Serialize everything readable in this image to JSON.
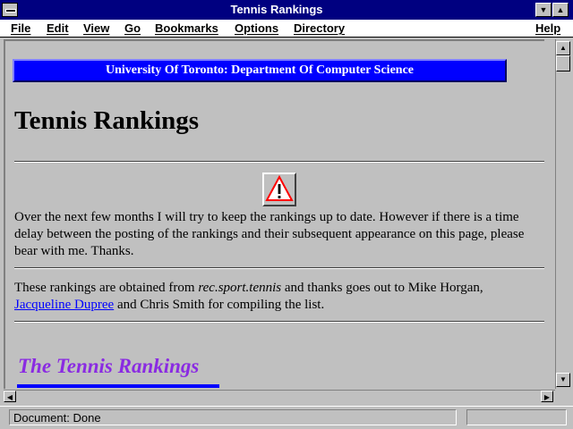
{
  "window": {
    "title": "Tennis Rankings"
  },
  "titlebar": {
    "minimize_glyph": "▼",
    "maximize_glyph": "▲"
  },
  "menu": {
    "file": "File",
    "edit": "Edit",
    "view": "View",
    "go": "Go",
    "bookmarks": "Bookmarks",
    "options": "Options",
    "directory": "Directory",
    "help": "Help"
  },
  "page": {
    "banner": "University Of Toronto: Department Of Computer Science",
    "title": "Tennis Rankings",
    "warning_icon": "warning-triangle-icon",
    "intro": "Over the next few months I will try to keep the rankings up to date. However if there is a time delay between the posting of the rankings and their subsequent appearance on this page, please bear with me. Thanks.",
    "source_prefix": "These rankings are obtained from ",
    "source_group": "rec.sport.tennis",
    "source_middle": " and thanks goes out to Mike Horgan, ",
    "source_link": "Jacqueline Dupree",
    "source_suffix": " and Chris Smith for compiling the list.",
    "section_heading": "The Tennis Rankings"
  },
  "scrollbar": {
    "up": "▲",
    "down": "▼",
    "left": "◀",
    "right": "▶"
  },
  "status": {
    "text": "Document: Done"
  },
  "colors": {
    "titlebar": "#000080",
    "banner": "#0000ff",
    "link": "#0000ff",
    "heading": "#8a2be2"
  }
}
